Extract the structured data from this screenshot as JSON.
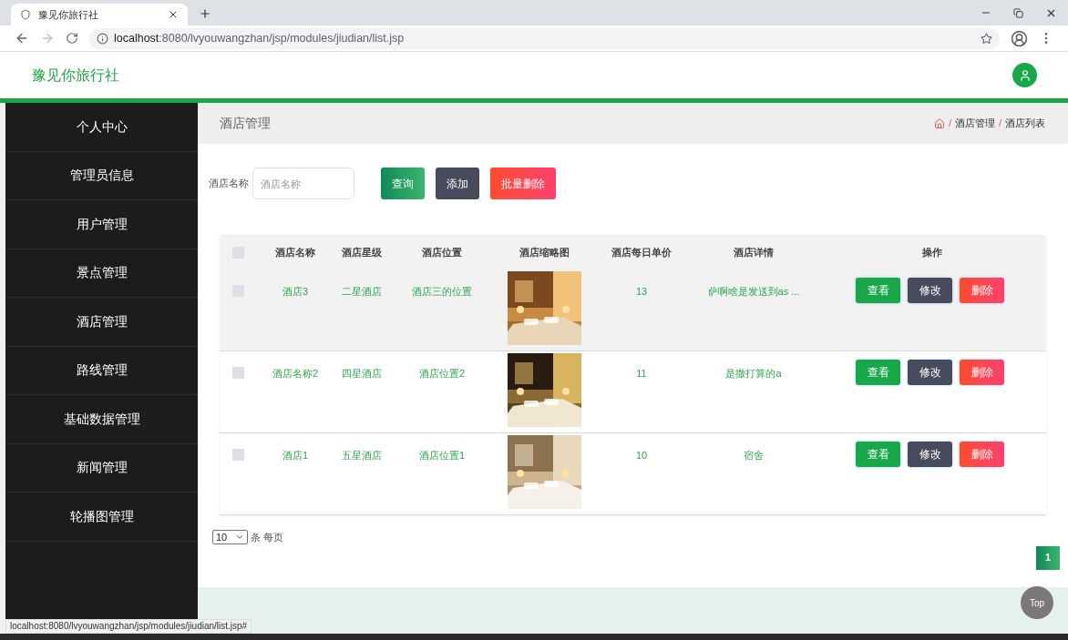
{
  "browser": {
    "tab_title": "豫见你旅行社",
    "url_host": "localhost",
    "url_path": ":8080/lvyouwangzhan/jsp/modules/jiudian/list.jsp",
    "status_url": "localhost:8080/lvyouwangzhan/jsp/modules/jiudian/list.jsp#"
  },
  "header": {
    "brand": "豫见你旅行社"
  },
  "sidebar": {
    "items": [
      {
        "label": "个人中心"
      },
      {
        "label": "管理员信息"
      },
      {
        "label": "用户管理"
      },
      {
        "label": "景点管理"
      },
      {
        "label": "酒店管理"
      },
      {
        "label": "路线管理"
      },
      {
        "label": "基础数据管理"
      },
      {
        "label": "新闻管理"
      },
      {
        "label": "轮播图管理"
      }
    ]
  },
  "breadcrumb": {
    "page_title": "酒店管理",
    "separator": "/",
    "trail": [
      "酒店管理",
      "酒店列表"
    ]
  },
  "search": {
    "label": "酒店名称",
    "placeholder": "酒店名称",
    "buttons": [
      {
        "label": "查询",
        "kind": "query"
      },
      {
        "label": "添加",
        "kind": "add"
      },
      {
        "label": "批量删除",
        "kind": "delete"
      }
    ]
  },
  "table": {
    "select_all_checked": false,
    "columns": [
      "酒店名称",
      "酒店星级",
      "酒店位置",
      "酒店缩略图",
      "酒店每日单价",
      "酒店详情",
      "操作"
    ],
    "rows": [
      {
        "checked": false,
        "hovered": true,
        "name": "酒店3",
        "star": "二星酒店",
        "location": "酒店三的位置",
        "price": "13",
        "detail": "萨啊啥是发送到as ...",
        "actions": [
          {
            "label": "查看",
            "kind": "view"
          },
          {
            "label": "修改",
            "kind": "edit"
          },
          {
            "label": "删除",
            "kind": "delete"
          }
        ]
      },
      {
        "checked": false,
        "hovered": false,
        "name": "酒店名称2",
        "star": "四星酒店",
        "location": "酒店位置2",
        "price": "11",
        "detail": "是撒打算的a",
        "actions": [
          {
            "label": "查看",
            "kind": "view"
          },
          {
            "label": "修改",
            "kind": "edit"
          },
          {
            "label": "删除",
            "kind": "delete"
          }
        ]
      },
      {
        "checked": false,
        "hovered": false,
        "name": "酒店1",
        "star": "五星酒店",
        "location": "酒店位置1",
        "price": "10",
        "detail": "宿舍",
        "actions": [
          {
            "label": "查看",
            "kind": "view"
          },
          {
            "label": "修改",
            "kind": "edit"
          },
          {
            "label": "删除",
            "kind": "delete"
          }
        ]
      }
    ]
  },
  "pagination": {
    "page_size": "10",
    "per_page_text": "条 每页",
    "pages": [
      {
        "label": "1",
        "selected": true
      }
    ]
  },
  "back_to_top": "Top"
}
